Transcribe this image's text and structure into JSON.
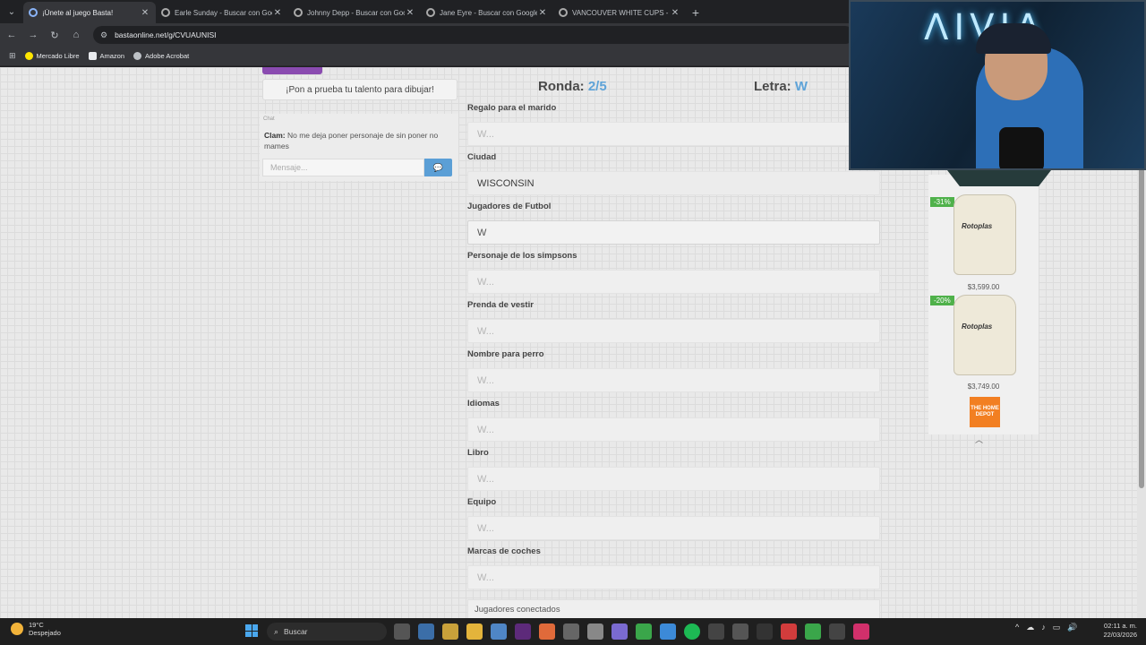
{
  "browser": {
    "tabs": [
      {
        "title": "¡Únete al juego Basta!",
        "active": true
      },
      {
        "title": "Earle Sunday - Buscar con Goo…",
        "active": false
      },
      {
        "title": "Johnny Depp - Buscar con Goo…",
        "active": false
      },
      {
        "title": "Jane Eyre - Buscar con Google",
        "active": false
      },
      {
        "title": "VANCOUVER WHITE CUPS - Bu…",
        "active": false
      }
    ],
    "url": "bastaonline.net/g/CVUAUNISI",
    "bookmarks": [
      "Mercado Libre",
      "Amazon",
      "Adobe Acrobat"
    ]
  },
  "game": {
    "draw_prompt": "¡Pon a prueba tu talento para dibujar!",
    "chat": {
      "label": "Chat",
      "author": "Clam:",
      "message": "No me deja poner personaje de sin poner no mames",
      "input_placeholder": "Mensaje..."
    },
    "round_label": "Ronda:",
    "round_value": "2/5",
    "letter_label": "Letra:",
    "letter_value": "W",
    "fields": [
      {
        "label": "Regalo para el marido",
        "value": "W..."
      },
      {
        "label": "Ciudad",
        "value": "WISCONSIN"
      },
      {
        "label": "Jugadores de Futbol",
        "value": "W"
      },
      {
        "label": "Personaje de los simpsons",
        "value": "W..."
      },
      {
        "label": "Prenda de vestir",
        "value": "W..."
      },
      {
        "label": "Nombre para perro",
        "value": "W..."
      },
      {
        "label": "Idiomas",
        "value": "W..."
      },
      {
        "label": "Libro",
        "value": "W..."
      },
      {
        "label": "Equipo",
        "value": "W..."
      },
      {
        "label": "Marcas de coches",
        "value": "W..."
      }
    ],
    "connected_label": "Jugadores conectados"
  },
  "ad": {
    "items": [
      {
        "discount": "-31%",
        "brand": "Rotoplas",
        "price": "$3,599.00"
      },
      {
        "discount": "-20%",
        "brand": "Rotoplas",
        "price": "$3,749.00"
      }
    ],
    "logo_text": "THE HOME DEPOT"
  },
  "stream": {
    "neon_text": "ΛIVIA"
  },
  "taskbar": {
    "temperature": "19°C",
    "weather": "Despejado",
    "search_placeholder": "Buscar",
    "time": "02:11 a. m.",
    "date": "22/03/2026"
  }
}
